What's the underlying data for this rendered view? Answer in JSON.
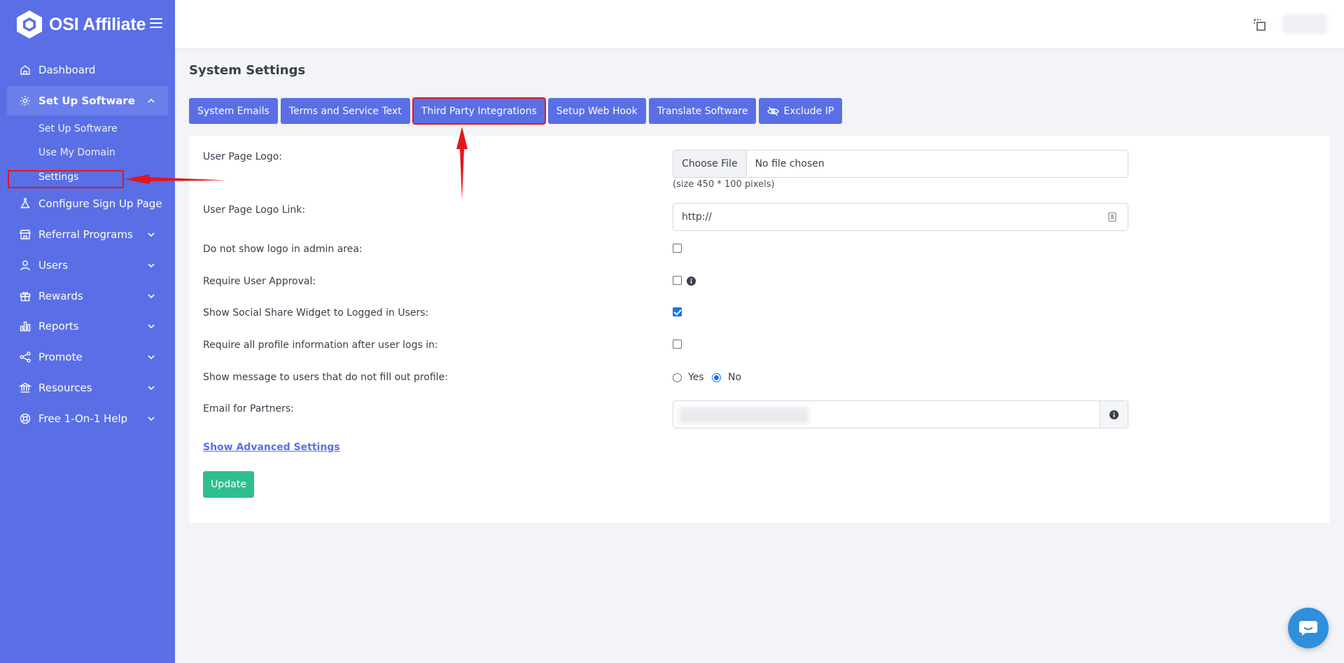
{
  "app": {
    "brand_name": "OSI Affiliate"
  },
  "sidebar": {
    "items": [
      {
        "label": "Dashboard",
        "icon": "home-icon"
      },
      {
        "label": "Set Up Software",
        "icon": "gear-icon",
        "expanded": true
      },
      {
        "label": "Configure Sign Up Page",
        "icon": "flask-icon"
      },
      {
        "label": "Referral Programs",
        "icon": "store-icon"
      },
      {
        "label": "Users",
        "icon": "user-icon"
      },
      {
        "label": "Rewards",
        "icon": "gift-icon"
      },
      {
        "label": "Reports",
        "icon": "bar-chart-icon"
      },
      {
        "label": "Promote",
        "icon": "share-icon"
      },
      {
        "label": "Resources",
        "icon": "bank-icon"
      },
      {
        "label": "Free 1-On-1 Help",
        "icon": "lifebuoy-icon"
      }
    ],
    "subitems": [
      {
        "label": "Set Up Software"
      },
      {
        "label": "Use My Domain"
      },
      {
        "label": "Settings",
        "current": true
      }
    ]
  },
  "page": {
    "title": "System Settings"
  },
  "tabs": [
    {
      "label": "System Emails"
    },
    {
      "label": "Terms and Service Text"
    },
    {
      "label": "Third Party Integrations",
      "highlighted": true
    },
    {
      "label": "Setup Web Hook"
    },
    {
      "label": "Translate Software"
    },
    {
      "label": "Exclude IP",
      "icon": "eye-slash-icon"
    }
  ],
  "form": {
    "user_page_logo": {
      "label": "User Page Logo:",
      "button": "Choose File",
      "file_text": "No file chosen",
      "hint": "(size 450 * 100 pixels)"
    },
    "user_page_logo_link": {
      "label": "User Page Logo Link:",
      "value": "http://"
    },
    "hide_logo_admin": {
      "label": "Do not show logo in admin area:",
      "checked": false
    },
    "require_approval": {
      "label": "Require User Approval:",
      "checked": false
    },
    "social_share_widget": {
      "label": "Show Social Share Widget to Logged in Users:",
      "checked": true
    },
    "require_profile": {
      "label": "Require all profile information after user logs in:",
      "checked": false
    },
    "show_message": {
      "label": "Show message to users that do not fill out profile:",
      "options": [
        "Yes",
        "No"
      ],
      "selected": "No"
    },
    "email_for_partners": {
      "label": "Email for Partners:"
    },
    "advanced_link": "Show Advanced Settings",
    "update_button": "Update"
  },
  "colors": {
    "sidebar": "#5a6fe6",
    "primary": "#5a6fe6",
    "success": "#2ebf8c",
    "annotation": "#e3171b"
  }
}
